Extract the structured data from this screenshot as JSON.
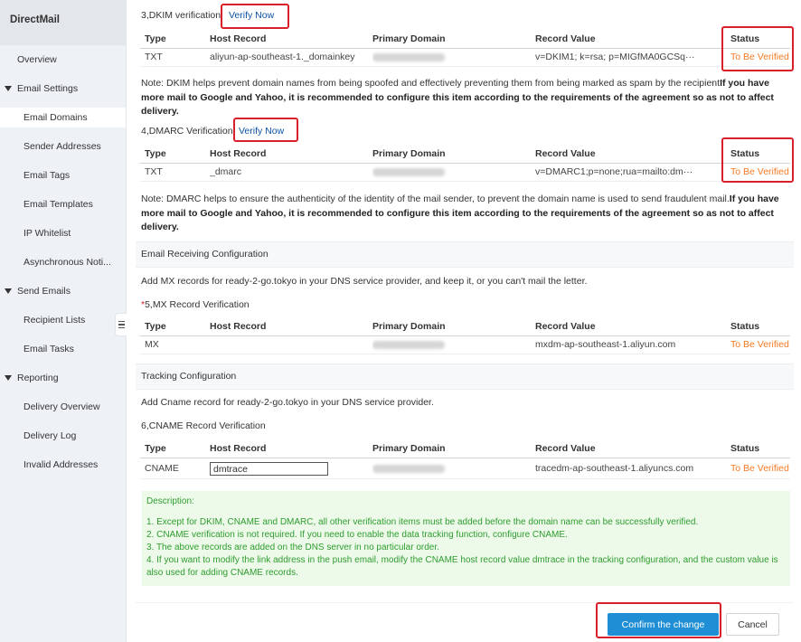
{
  "app": {
    "title": "DirectMail"
  },
  "sidebar": {
    "items": [
      {
        "label": "Overview"
      },
      {
        "label": "Email Settings"
      },
      {
        "label": "Email Domains"
      },
      {
        "label": "Sender Addresses"
      },
      {
        "label": "Email Tags"
      },
      {
        "label": "Email Templates"
      },
      {
        "label": "IP Whitelist"
      },
      {
        "label": "Asynchronous Noti..."
      },
      {
        "label": "Send Emails"
      },
      {
        "label": "Recipient Lists"
      },
      {
        "label": "Email Tasks"
      },
      {
        "label": "Reporting"
      },
      {
        "label": "Delivery Overview"
      },
      {
        "label": "Delivery Log"
      },
      {
        "label": "Invalid Addresses"
      }
    ]
  },
  "columns": {
    "type": "Type",
    "host": "Host Record",
    "domain": "Primary Domain",
    "value": "Record Value",
    "status": "Status"
  },
  "dkim": {
    "title": "3,DKIM verification",
    "verify_label": "Verify Now",
    "row": {
      "type": "TXT",
      "host": "aliyun-ap-southeast-1._domainkey",
      "value": "v=DKIM1; k=rsa; p=MIGfMA0GCSq···",
      "status": "To Be Verified"
    },
    "note_plain": "Note: DKIM helps prevent domain names from being spoofed and effectively preventing them from being marked as spam by the recipient",
    "note_bold": "If you have more mail to Google and Yahoo, it is recommended to configure this item according to the requirements of the agreement so as not to affect delivery."
  },
  "dmarc": {
    "title": "4,DMARC Verification",
    "verify_label": "Verify Now",
    "row": {
      "type": "TXT",
      "host": "_dmarc",
      "value": "v=DMARC1;p=none;rua=mailto:dm···",
      "status": "To Be Verified"
    },
    "note_plain": "Note: DMARC helps to ensure the authenticity of the identity of the mail sender, to prevent the domain name is used to send fraudulent mail.",
    "note_bold": "If you have more mail to Google and Yahoo, it is recommended to configure this item according to the requirements of the agreement so as not to affect delivery."
  },
  "receiving": {
    "section": "Email Receiving Configuration",
    "instruction": "Add MX records for ready-2-go.tokyo in your DNS service provider, and keep it, or you can't mail the letter.",
    "required_mark": "*",
    "title": "5,MX Record Verification",
    "row": {
      "type": "MX",
      "host": "",
      "value": "mxdm-ap-southeast-1.aliyun.com",
      "status": "To Be Verified"
    }
  },
  "tracking": {
    "section": "Tracking Configuration",
    "instruction": "Add Cname record for ready-2-go.tokyo in your DNS service provider.",
    "title": "6,CNAME Record Verification",
    "row": {
      "type": "CNAME",
      "host_value": "dmtrace",
      "value": "tracedm-ap-southeast-1.aliyuncs.com",
      "status": "To Be Verified"
    }
  },
  "description": {
    "title": "Description:",
    "items": [
      "1. Except for DKIM, CNAME and DMARC, all other verification items must be added before the domain name can be successfully verified.",
      "2. CNAME verification is not required. If you need to enable the data tracking function, configure CNAME.",
      "3. The above records are added on the DNS server in no particular order.",
      "4. If you want to modify the link address in the push email, modify the CNAME host record value dmtrace in the tracking configuration, and the custom value is also used for adding CNAME records."
    ]
  },
  "actions": {
    "confirm_label": "Confirm the change",
    "cancel_label": "Cancel"
  },
  "colors": {
    "highlight": "#d9202a",
    "status": "#f57a21",
    "link": "#0b53a6",
    "primary": "#1f8ed4",
    "description_text": "#2e9c2e",
    "description_bg": "#edfaea"
  }
}
